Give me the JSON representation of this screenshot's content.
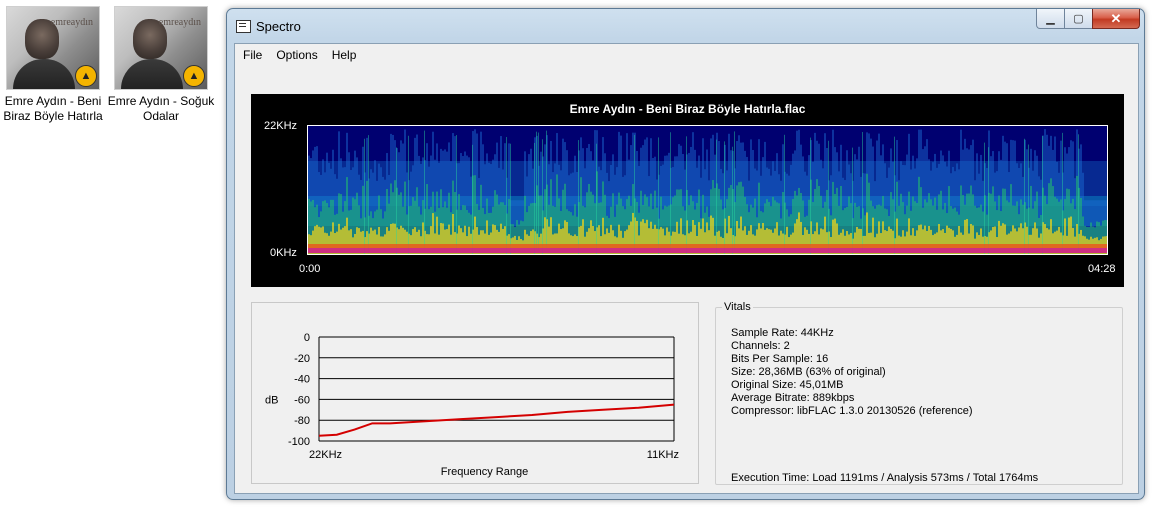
{
  "desktop": {
    "icons": [
      {
        "label": "Emre Aydın - Beni Biraz Böyle Hatırla",
        "thumb_brand": "emreaydın"
      },
      {
        "label": "Emre Aydın - Soğuk Odalar",
        "thumb_brand": "emreaydın"
      }
    ]
  },
  "window": {
    "title": "Spectro",
    "controls": {
      "minimize": "▁",
      "maximize": "▢",
      "close": "✕"
    },
    "menu": [
      "File",
      "Options",
      "Help"
    ]
  },
  "spectrogram": {
    "title": "Emre Aydın - Beni Biraz Böyle Hatırla.flac",
    "y_top_label": "22KHz",
    "y_bottom_label": "0KHz",
    "x_start_label": "0:00",
    "x_end_label": "04:28"
  },
  "chart_data": {
    "type": "line",
    "title": "",
    "xlabel": "Frequency Range",
    "ylabel": "dB",
    "x_tick_labels": [
      "22KHz",
      "11KHz"
    ],
    "y_ticks": [
      0,
      -20,
      -40,
      -60,
      -80,
      -100
    ],
    "ylim": [
      -100,
      0
    ],
    "grid": true,
    "series": [
      {
        "color": "#d40000",
        "x": [
          0,
          0.05,
          0.1,
          0.15,
          0.2,
          0.3,
          0.4,
          0.5,
          0.6,
          0.7,
          0.8,
          0.9,
          1.0
        ],
        "values": [
          -95,
          -94,
          -89,
          -83,
          -83,
          -81,
          -79,
          -77,
          -75,
          -72,
          -70,
          -68,
          -65
        ]
      }
    ]
  },
  "vitals": {
    "legend": "Vitals",
    "lines": [
      "Sample Rate: 44KHz",
      "Channels: 2",
      "Bits Per Sample: 16",
      "Size: 28,36MB (63% of original)",
      "Original Size: 45,01MB",
      "Average Bitrate: 889kbps",
      "Compressor: libFLAC 1.3.0 20130526 (reference)"
    ],
    "execution_time": "Execution Time: Load 1191ms / Analysis 573ms / Total 1764ms"
  }
}
